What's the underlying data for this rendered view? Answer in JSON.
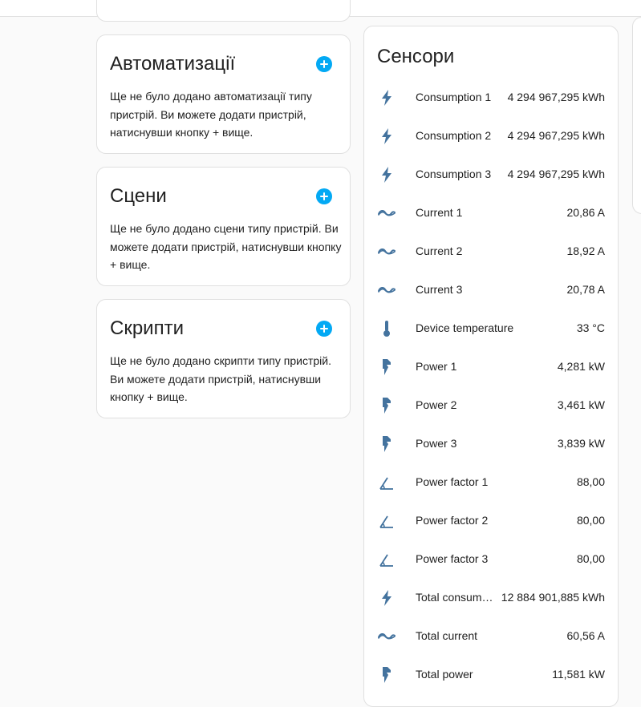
{
  "automations": {
    "title": "Автоматизації",
    "text": "Ще не було додано автоматизації типу пристрій. Ви можете додати пристрій, натиснувши кнопку + вище."
  },
  "scenes": {
    "title": "Сцени",
    "text": "Ще не було додано сцени типу пристрій. Ви можете додати пристрій, натиснувши кнопку + вище."
  },
  "scripts": {
    "title": "Скрипти",
    "text": "Ще не було додано скрипти типу пристрій. Ви можете додати пристрій, натиснувши кнопку + вище."
  },
  "sensors": {
    "title": "Сенсори",
    "icon_color": "#44739e",
    "accent_color": "#03a9f4",
    "items": [
      {
        "icon": "flash-icon",
        "name": "Consumption 1",
        "value": "4 294 967,295 kWh"
      },
      {
        "icon": "flash-icon",
        "name": "Consumption 2",
        "value": "4 294 967,295 kWh"
      },
      {
        "icon": "flash-icon",
        "name": "Consumption 3",
        "value": "4 294 967,295 kWh"
      },
      {
        "icon": "current-ac-icon",
        "name": "Current 1",
        "value": "20,86 A"
      },
      {
        "icon": "current-ac-icon",
        "name": "Current 2",
        "value": "18,92 A"
      },
      {
        "icon": "current-ac-icon",
        "name": "Current 3",
        "value": "20,78 A"
      },
      {
        "icon": "thermometer-icon",
        "name": "Device temperature",
        "value": "33 °C"
      },
      {
        "icon": "power-flash-icon",
        "name": "Power 1",
        "value": "4,281 kW"
      },
      {
        "icon": "power-flash-icon",
        "name": "Power 2",
        "value": "3,461 kW"
      },
      {
        "icon": "power-flash-icon",
        "name": "Power 3",
        "value": "3,839 kW"
      },
      {
        "icon": "angle-acute-icon",
        "name": "Power factor 1",
        "value": "88,00"
      },
      {
        "icon": "angle-acute-icon",
        "name": "Power factor 2",
        "value": "80,00"
      },
      {
        "icon": "angle-acute-icon",
        "name": "Power factor 3",
        "value": "80,00"
      },
      {
        "icon": "flash-icon",
        "name": "Total consumption",
        "value": "12 884 901,885 kWh"
      },
      {
        "icon": "current-ac-icon",
        "name": "Total current",
        "value": "60,56 A"
      },
      {
        "icon": "power-flash-icon",
        "name": "Total power",
        "value": "11,581 kW"
      }
    ]
  }
}
